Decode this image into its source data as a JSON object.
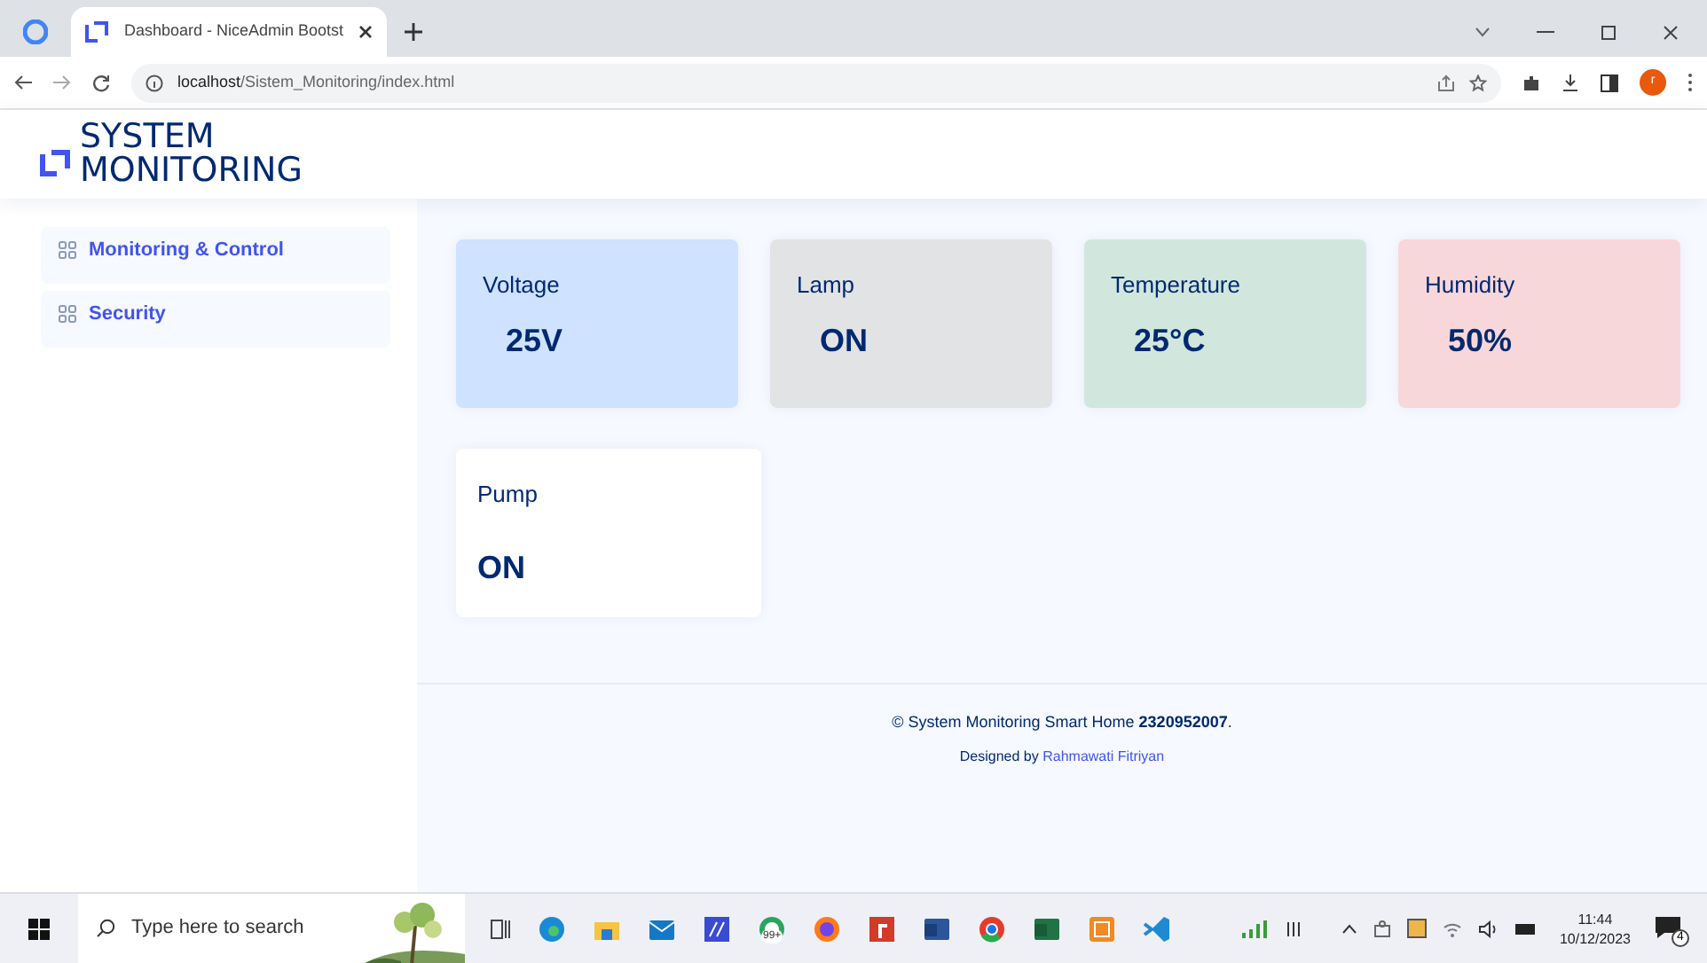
{
  "browser": {
    "tab_title": "Dashboard - NiceAdmin Bootst",
    "url_host": "localhost",
    "url_path": "/Sistem_Monitoring/index.html",
    "profile_initial": "r"
  },
  "header": {
    "logo_line_1": "SYSTEM",
    "logo_line_2": "MONITORING"
  },
  "sidebar": {
    "items": [
      {
        "label": "Monitoring & Control"
      },
      {
        "label": "Security"
      }
    ]
  },
  "cards": [
    {
      "title": "Voltage",
      "value": "25V",
      "color": "#cfe2ff"
    },
    {
      "title": "Lamp",
      "value": "ON",
      "color": "#e2e3e5"
    },
    {
      "title": "Temperature",
      "value": "25°C",
      "color": "#d1e7dd"
    },
    {
      "title": "Humidity",
      "value": "50%",
      "color": "#f8d7da"
    },
    {
      "title": "Pump",
      "value": "ON",
      "color": "#ffffff"
    }
  ],
  "footer": {
    "copyright": "© System Monitoring Smart Home **2320952007**.",
    "designed_by": "Designed by",
    "author": "Rahmawati Fitriyan"
  },
  "taskbar": {
    "search_placeholder": "Type here to search",
    "badge": "99+",
    "time": "11:44",
    "date": "10/12/2023",
    "notifications": "4"
  }
}
